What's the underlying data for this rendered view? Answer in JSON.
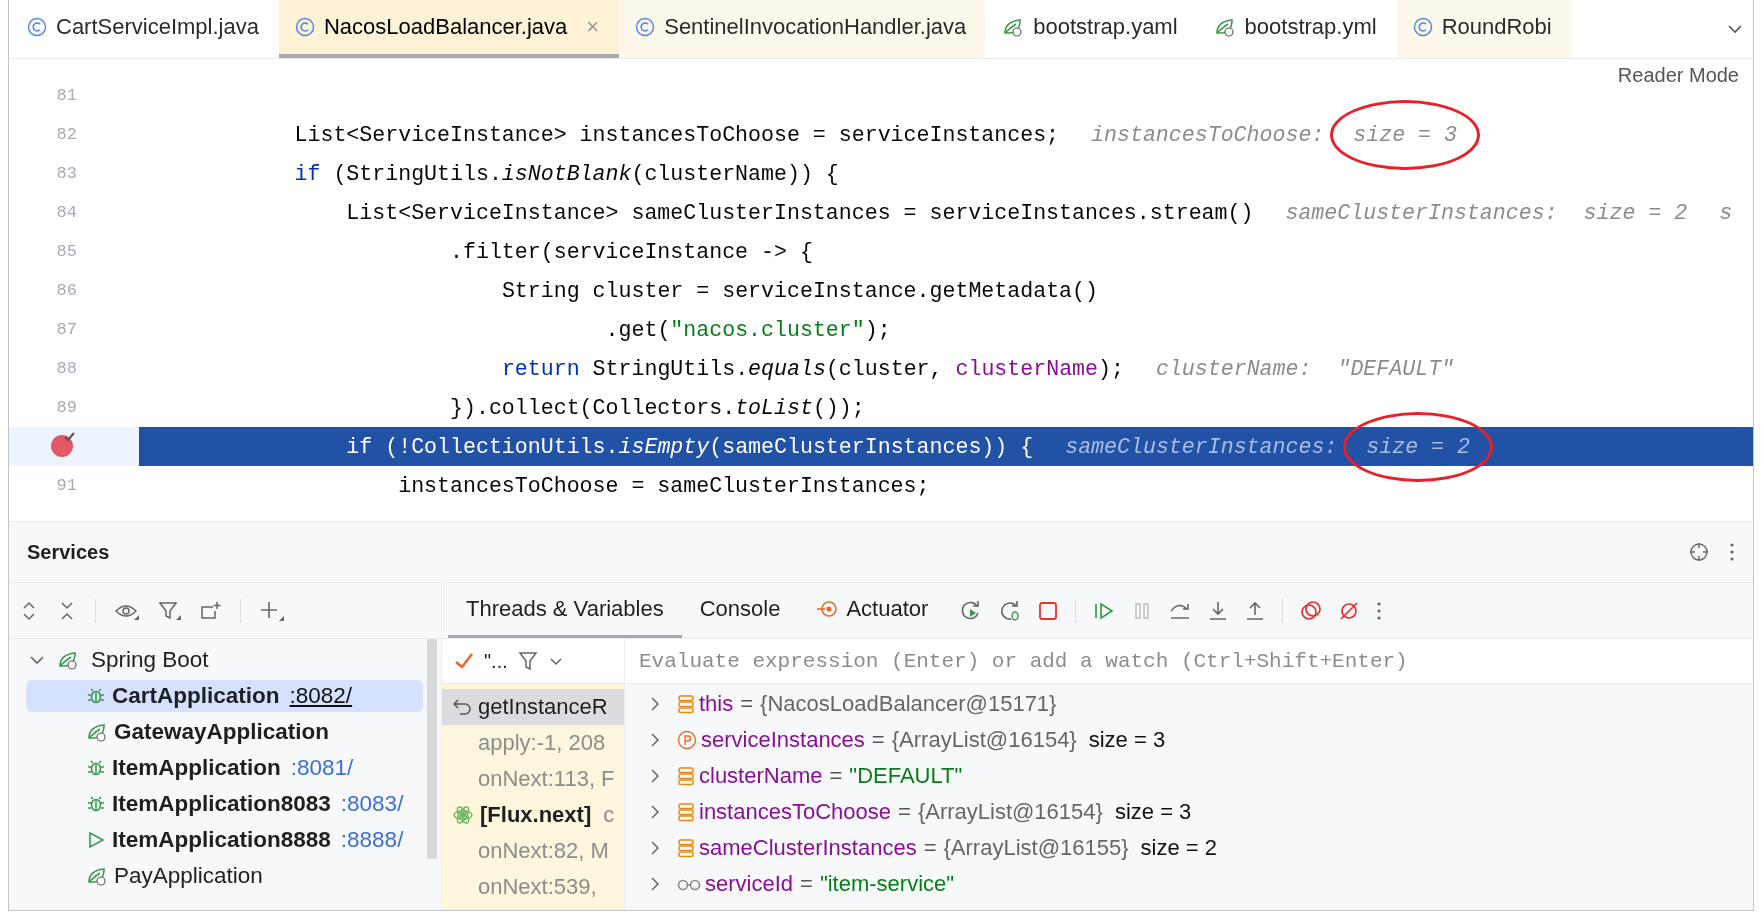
{
  "editor_tabs": [
    {
      "label": "CartServiceImpl.java",
      "kind": "class",
      "selected": false,
      "tinted": false
    },
    {
      "label": "NacosLoadBalancer.java",
      "kind": "class",
      "selected": true,
      "tinted": false,
      "close": "×"
    },
    {
      "label": "SentinelInvocationHandler.java",
      "kind": "class",
      "selected": false,
      "tinted": true
    },
    {
      "label": "bootstrap.yaml",
      "kind": "config",
      "selected": false,
      "tinted": false
    },
    {
      "label": "bootstrap.yml",
      "kind": "config",
      "selected": false,
      "tinted": false
    },
    {
      "label": "RoundRobi",
      "kind": "class",
      "selected": false,
      "tinted": true
    }
  ],
  "reader_mode": "Reader Mode",
  "code_lines": [
    {
      "number": "81"
    },
    {
      "number": "82",
      "wrapped": false,
      "tokens": [
        {
          "kind": "plain",
          "text": "List<ServiceInstance> instancesToChoose = serviceInstances;"
        }
      ],
      "hints": [
        {
          "label": "instancesToChoose:",
          "value": "size = 3",
          "circled": true
        }
      ]
    },
    {
      "number": "83",
      "wrapped": false,
      "tokens": [
        {
          "kind": "keyword",
          "text": "if"
        },
        {
          "kind": "plain",
          "text": " (StringUtils."
        },
        {
          "kind": "method",
          "text": "isNotBlank"
        },
        {
          "kind": "plain",
          "text": "(clusterName)) {"
        }
      ],
      "children": [
        {
          "number": "84",
          "wrapped": false,
          "tokens": [
            {
              "kind": "plain",
              "text": "List<ServiceInstance> sameClusterInstances = serviceInstances.stream()"
            }
          ],
          "hints": [
            {
              "label": "sameClusterInstances:",
              "value": "size = 2",
              "circled": false
            },
            {
              "label": "s"
            }
          ],
          "children": [
            {
              "number": "85",
              "wrapped": true,
              "tokens": [
                {
                  "kind": "plain",
                  "text": ".filter(serviceInstance -> {"
                }
              ],
              "children": [
                {
                  "number": "86",
                  "wrapped": false,
                  "tokens": [
                    {
                      "kind": "plain",
                      "text": "String cluster = serviceInstance.getMetadata()"
                    }
                  ],
                  "children": [
                    {
                      "number": "87",
                      "wrapped": true,
                      "tokens": [
                        {
                          "kind": "plain",
                          "text": ".get("
                        },
                        {
                          "kind": "string",
                          "text": "\"nacos.cluster\""
                        },
                        {
                          "kind": "plain",
                          "text": ");"
                        }
                      ]
                    }
                  ]
                },
                {
                  "number": "88",
                  "wrapped": false,
                  "tokens": [
                    {
                      "kind": "keyword",
                      "text": "return"
                    },
                    {
                      "kind": "plain",
                      "text": " StringUtils."
                    },
                    {
                      "kind": "method",
                      "text": "equals"
                    },
                    {
                      "kind": "plain",
                      "text": "(cluster, "
                    },
                    {
                      "kind": "field",
                      "text": "clusterName"
                    },
                    {
                      "kind": "plain",
                      "text": ");"
                    }
                  ],
                  "hints": [
                    {
                      "label": "clusterName:",
                      "value": "\"DEFAULT\"",
                      "circled": false
                    }
                  ]
                }
              ]
            },
            {
              "number": "89",
              "wrapped": true,
              "tokens": [
                {
                  "kind": "plain",
                  "text": "}).collect(Collectors."
                },
                {
                  "kind": "method",
                  "text": "toList"
                },
                {
                  "kind": "plain",
                  "text": "());"
                }
              ]
            }
          ]
        },
        {
          "breakpoint": true,
          "current": true,
          "wrapped": false,
          "tokens": [
            {
              "kind": "keyword",
              "text": "if"
            },
            {
              "kind": "plain",
              "text": " (!CollectionUtils."
            },
            {
              "kind": "method",
              "text": "isEmpty"
            },
            {
              "kind": "plain",
              "text": "(sameClusterInstances)) {"
            }
          ],
          "hints": [
            {
              "label": "sameClusterInstances:",
              "value": "size = 2",
              "circled": true
            }
          ],
          "children": [
            {
              "number": "91",
              "wrapped": false,
              "tokens": [
                {
                  "kind": "plain",
                  "text": "instancesToChoose = sameClusterInstances;"
                }
              ]
            }
          ]
        }
      ]
    }
  ],
  "services": {
    "title": "Services",
    "tree": [
      {
        "label": "Spring Boot",
        "kind": "group",
        "expanded": true,
        "children": [
          {
            "label": "CartApplication",
            "port": ":8082/",
            "kind": "debug",
            "running": true,
            "selected": true
          },
          {
            "label": "GatewayApplication",
            "kind": "spring",
            "running": true,
            "selected": false
          },
          {
            "label": "ItemApplication",
            "port": ":8081/",
            "kind": "debug",
            "running": true,
            "selected": false
          },
          {
            "label": "ItemApplication8083",
            "port": ":8083/",
            "kind": "debug",
            "running": true,
            "selected": false
          },
          {
            "label": "ItemApplication8888",
            "port": ":8888/",
            "kind": "run",
            "running": true,
            "selected": false
          },
          {
            "label": "PayApplication",
            "kind": "spring",
            "running": false,
            "selected": false
          }
        ]
      }
    ]
  },
  "debugger": {
    "tabs": [
      {
        "label": "Threads & Variables",
        "kind": "plain",
        "selected": true
      },
      {
        "label": "Console",
        "kind": "plain",
        "selected": false
      },
      {
        "label": "Actuator",
        "kind": "actuator",
        "selected": false
      }
    ],
    "thread_filter": "\"...",
    "frames": [
      {
        "kind": "current",
        "text": "getInstanceR",
        "selected": true
      },
      {
        "kind": "library",
        "text": "apply:-1, 208",
        "selected": false
      },
      {
        "kind": "library",
        "text": "onNext:113, F",
        "selected": false
      },
      {
        "kind": "thread",
        "text": "[Flux.next]",
        "detail": "c",
        "selected": false
      },
      {
        "kind": "library",
        "text": "onNext:82, M",
        "selected": false
      },
      {
        "kind": "library",
        "text": "onNext:539,",
        "selected": false
      }
    ],
    "evaluate": {
      "placeholder": "Evaluate expression (Enter) or add a watch (Ctrl+Shift+Enter)"
    },
    "variables": [
      {
        "kind": "field",
        "name": "this",
        "operator": "=",
        "value": "{NacosLoadBalancer@15171}",
        "string_value": false
      },
      {
        "kind": "parameter",
        "name": "serviceInstances",
        "operator": "=",
        "value": "{ArrayList@16154}",
        "string_value": false,
        "size": "size = 3"
      },
      {
        "kind": "field",
        "name": "clusterName",
        "operator": "=",
        "value": "\"DEFAULT\"",
        "string_value": true
      },
      {
        "kind": "field",
        "name": "instancesToChoose",
        "operator": "=",
        "value": "{ArrayList@16154}",
        "string_value": false,
        "size": "size = 3"
      },
      {
        "kind": "field",
        "name": "sameClusterInstances",
        "operator": "=",
        "value": "{ArrayList@16155}",
        "string_value": false,
        "size": "size = 2"
      },
      {
        "kind": "watch",
        "name": "serviceId",
        "operator": "=",
        "value": "\"item-service\"",
        "string_value": true
      }
    ]
  }
}
